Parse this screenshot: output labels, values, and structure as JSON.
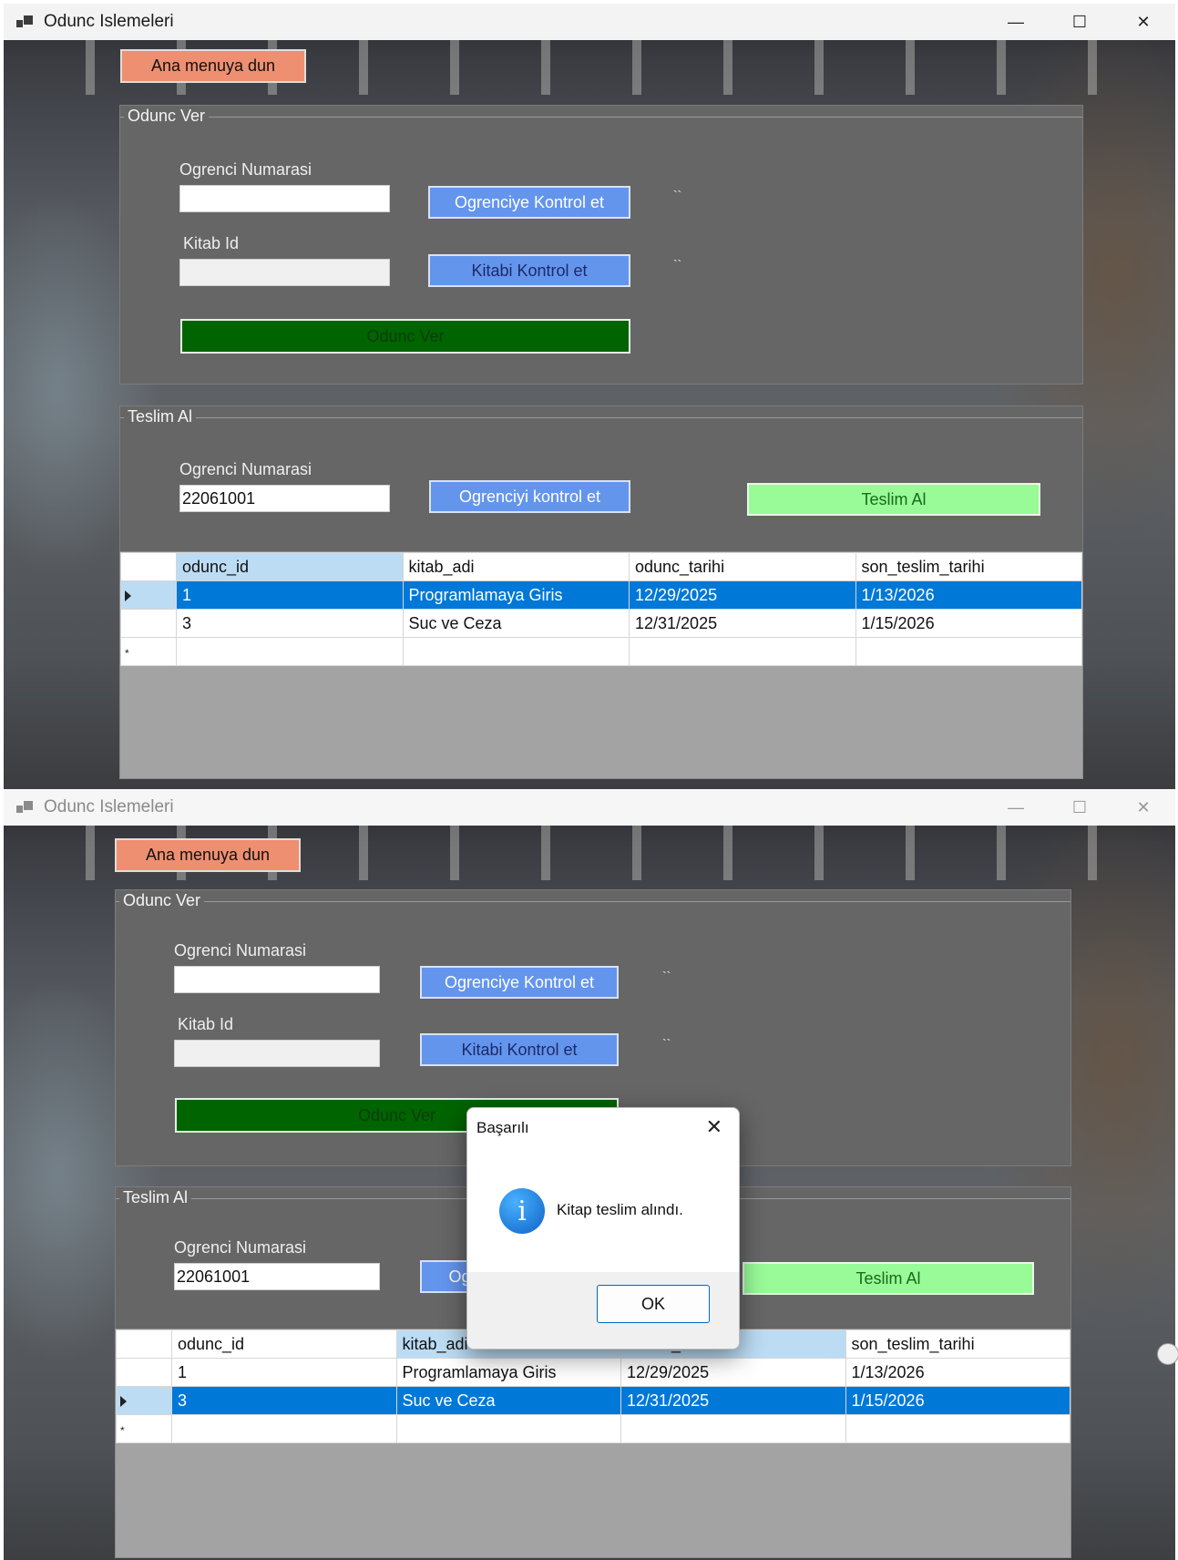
{
  "window": {
    "title": "Odunc Islemeleri",
    "minimize_glyph": "—",
    "maximize_glyph": "☐",
    "close_glyph": "✕"
  },
  "top_button": "Ana menuya dun",
  "odunc_ver": {
    "legend": "Odunc Ver",
    "ogrenci_label": "Ogrenci Numarasi",
    "ogrenci_value": "",
    "ogrenci_check_button": "Ogrenciye Kontrol et",
    "ogrenci_status": "``",
    "kitab_label": "Kitab Id",
    "kitab_value": "",
    "kitab_check_button": "Kitabi Kontrol et",
    "kitab_status": "``",
    "submit_button": "Odunc Ver"
  },
  "teslim_al": {
    "legend": "Teslim Al",
    "ogrenci_label": "Ogrenci Numarasi",
    "ogrenci_value": "22061001",
    "check_button": "Ogrenciyi kontrol et",
    "submit_button": "Teslim Al"
  },
  "grid": {
    "columns": [
      "odunc_id",
      "kitab_adi",
      "odunc_tarihi",
      "son_teslim_tarihi"
    ],
    "before_rows": [
      [
        "1",
        "Programlamaya Giris",
        "12/29/2025",
        "1/13/2026"
      ],
      [
        "3",
        "Suc ve Ceza",
        "12/31/2025",
        "1/15/2026"
      ]
    ],
    "after_rows": [
      [
        "1",
        "Programlamaya Giris",
        "12/29/2025",
        "1/13/2026"
      ],
      [
        "3",
        "Suc ve Ceza",
        "12/31/2025",
        "1/15/2026"
      ]
    ],
    "before_selected_index": 0,
    "after_selected_index": 1,
    "new_row_marker": "*"
  },
  "dialog": {
    "title": "Başarılı",
    "message": "Kitap teslim alındı.",
    "ok_button": "OK",
    "close_glyph": "✕",
    "icon": "info-icon",
    "icon_glyph": "i"
  },
  "colors": {
    "menu_button": "#ef8f72",
    "group_bg": "#666666",
    "blue_button": "#6495ed",
    "dark_green": "#006400",
    "light_green": "#98fb98",
    "selection": "#0078d7"
  }
}
